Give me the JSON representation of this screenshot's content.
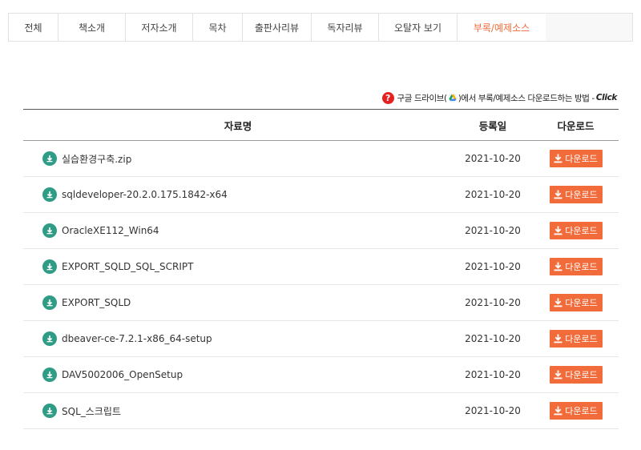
{
  "tabs": [
    {
      "label": "전체",
      "width": 62
    },
    {
      "label": "책소개",
      "width": 84
    },
    {
      "label": "저자소개",
      "width": 84
    },
    {
      "label": "목차",
      "width": 62
    },
    {
      "label": "출판사리뷰",
      "width": 86
    },
    {
      "label": "독자리뷰",
      "width": 84
    },
    {
      "label": "오탈자 보기",
      "width": 98
    },
    {
      "label": "부록/예제소스",
      "width": 110,
      "active": true
    }
  ],
  "guide": {
    "before": "구글 드라이브(",
    "after": ")에서 부록/예제소스 다운로드하는 방법 -",
    "click": "Click"
  },
  "table": {
    "headers": {
      "name": "자료명",
      "date": "등록일",
      "download": "다운로드"
    },
    "button_label": "다운로드",
    "rows": [
      {
        "name": "실습환경구축.zip",
        "date": "2021-10-20"
      },
      {
        "name": "sqldeveloper-20.2.0.175.1842-x64",
        "date": "2021-10-20"
      },
      {
        "name": "OracleXE112_Win64",
        "date": "2021-10-20"
      },
      {
        "name": "EXPORT_SQLD_SQL_SCRIPT",
        "date": "2021-10-20"
      },
      {
        "name": "EXPORT_SQLD",
        "date": "2021-10-20"
      },
      {
        "name": "dbeaver-ce-7.2.1-x86_64-setup",
        "date": "2021-10-20"
      },
      {
        "name": "DAV5002006_OpenSetup",
        "date": "2021-10-20"
      },
      {
        "name": "SQL_스크립트",
        "date": "2021-10-20"
      }
    ]
  },
  "colors": {
    "accent": "#f26c3b",
    "icon_teal": "#2f9c86",
    "help_red": "#e52020"
  }
}
